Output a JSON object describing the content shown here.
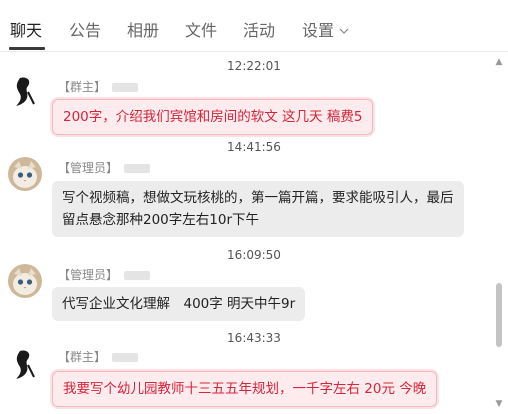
{
  "tabs": [
    {
      "label": "聊天"
    },
    {
      "label": "公告"
    },
    {
      "label": "相册"
    },
    {
      "label": "文件"
    },
    {
      "label": "活动"
    },
    {
      "label": "设置"
    }
  ],
  "messages": [
    {
      "time": "12:22:01",
      "role": "【群主】",
      "text": "200字，介绍我们宾馆和房间的软文 这几天 稿费5",
      "style": "pink"
    },
    {
      "time": "14:41:56",
      "role": "【管理员】",
      "text": "写个视频稿，想做文玩核桃的，第一篇开篇，要求能吸引人，最后留点悬念那种200字左右10r下午",
      "style": "gray"
    },
    {
      "time": "16:09:50",
      "role": "【管理员】",
      "text": "代写企业文化理解　400字 明天中午9r",
      "style": "gray"
    },
    {
      "time": "16:43:33",
      "role": "【群主】",
      "text": "我要写个幼儿园教师十三五五年规划，一千字左右 20元 今晚",
      "style": "pink"
    }
  ],
  "colors": {
    "accent_pink": "#d6243b",
    "bubble_pink": "#fdebed",
    "bubble_gray": "#ececec"
  }
}
